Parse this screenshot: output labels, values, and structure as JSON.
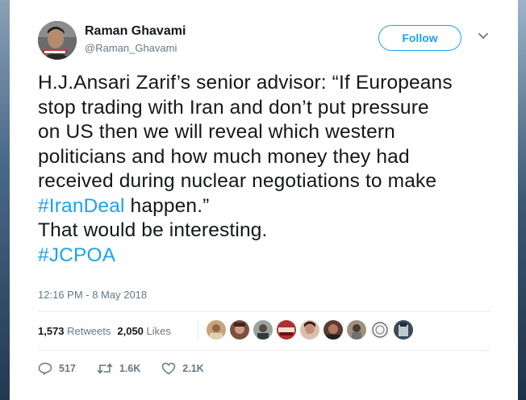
{
  "user": {
    "name": "Raman Ghavami",
    "handle": "@Raman_Ghavami",
    "follow_label": "Follow"
  },
  "tweet": {
    "line1": "H.J.Ansari Zarif’s senior advisor: “If Europeans",
    "line2": "stop trading with Iran and don’t put pressure",
    "line3": "on US then we will reveal which western",
    "line4": "politicians and how much money they had",
    "line5": "received during nuclear negotiations to make",
    "line6_hashtag": "#IranDeal",
    "line6_rest": " happen.”",
    "line7": "That would be interesting.",
    "line8_hashtag": "#JCPOA",
    "timestamp": "12:16 PM - 8 May 2018"
  },
  "stats": {
    "retweets_count": "1,573",
    "retweets_label": "Retweets",
    "likes_count": "2,050",
    "likes_label": "Likes"
  },
  "actions": {
    "replies": "517",
    "retweets": "1.6K",
    "likes": "2.1K"
  },
  "colors": {
    "accent": "#1da1f2",
    "text": "#14171a",
    "muted": "#657786"
  }
}
